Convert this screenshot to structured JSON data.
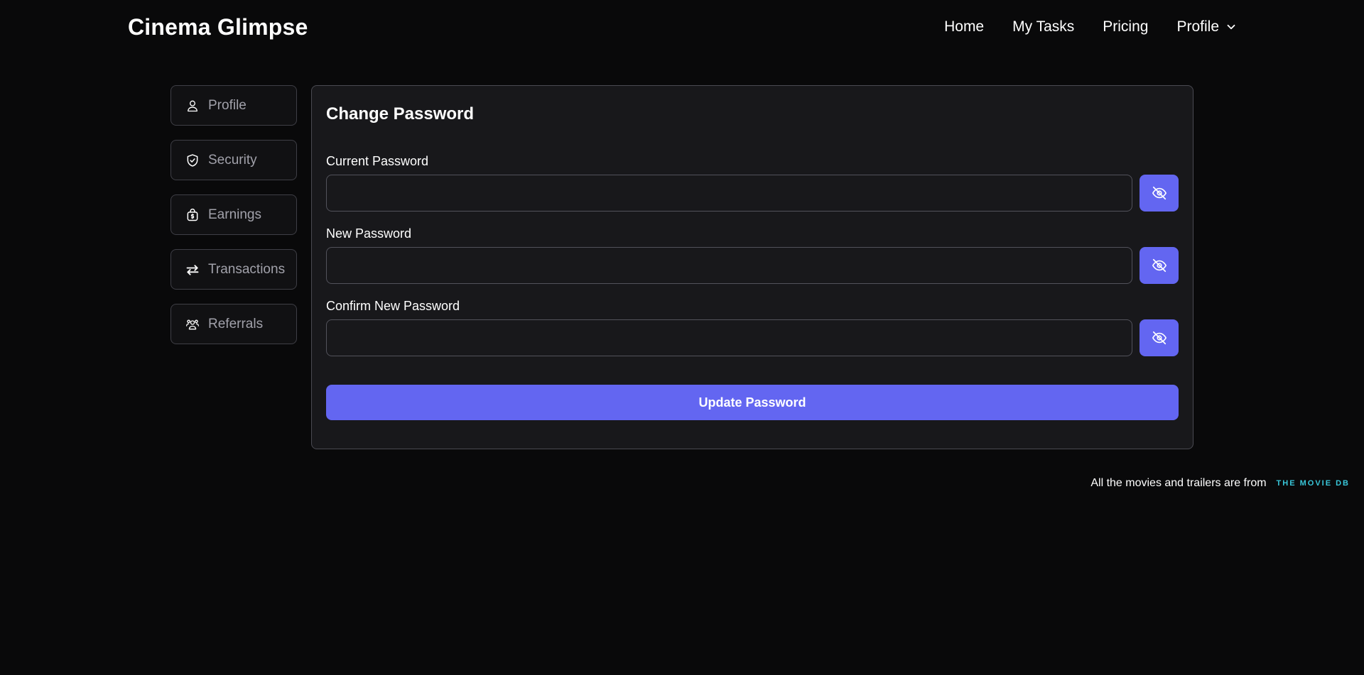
{
  "brand": "Cinema Glimpse",
  "nav": {
    "items": [
      "Home",
      "My Tasks",
      "Pricing"
    ],
    "profile_label": "Profile"
  },
  "sidebar": {
    "items": [
      {
        "label": "Profile",
        "icon": "user-icon"
      },
      {
        "label": "Security",
        "icon": "shield-check-icon"
      },
      {
        "label": "Earnings",
        "icon": "money-bag-icon"
      },
      {
        "label": "Transactions",
        "icon": "arrows-swap-icon"
      },
      {
        "label": "Referrals",
        "icon": "users-icon"
      }
    ]
  },
  "form": {
    "title": "Change Password",
    "fields": [
      {
        "label": "Current Password",
        "value": ""
      },
      {
        "label": "New Password",
        "value": ""
      },
      {
        "label": "Confirm New Password",
        "value": ""
      }
    ],
    "toggle_icon": "eye-off-icon",
    "submit_label": "Update Password"
  },
  "footer": {
    "credit_text": "All the movies and trailers are from",
    "tmdb_logo_text": "THE MOVIE DB"
  },
  "colors": {
    "background": "#09090a",
    "card": "#18181b",
    "accent": "#6366f1",
    "tmdb": "#38c6d9"
  }
}
